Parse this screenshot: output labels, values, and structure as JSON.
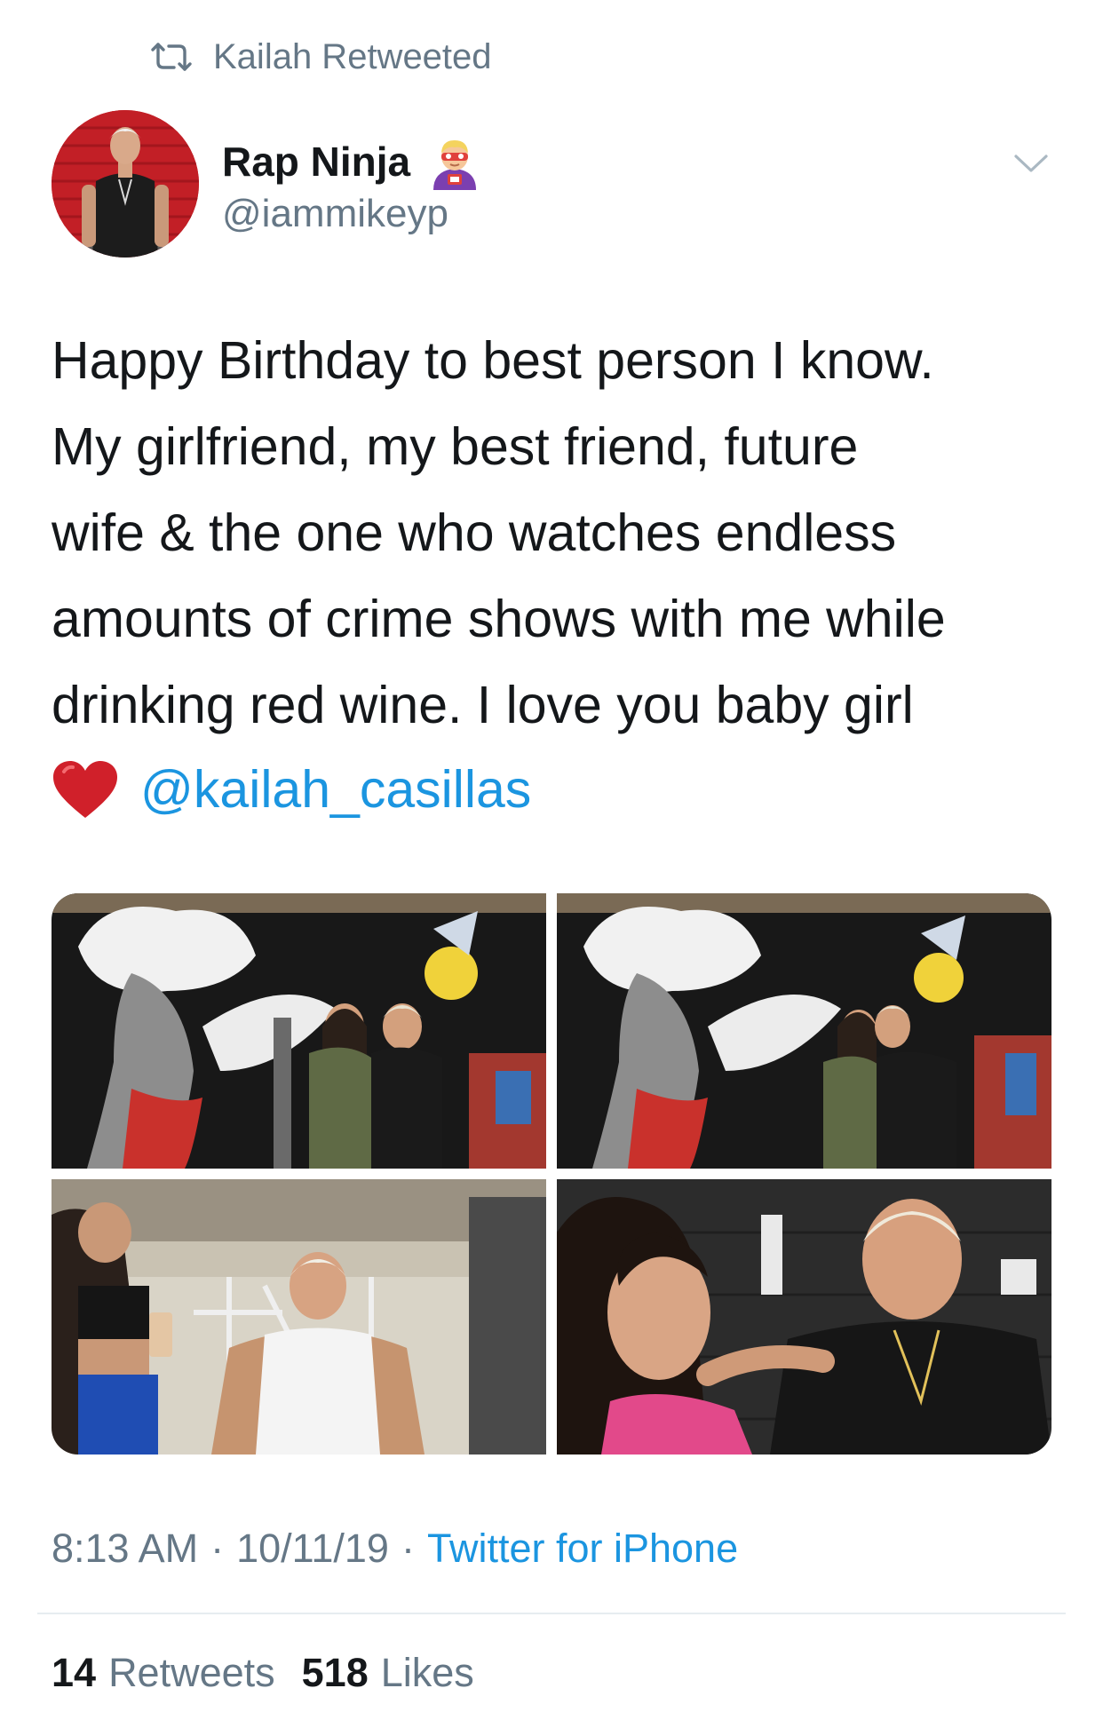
{
  "retweet_context": {
    "icon": "retweet-icon",
    "label": "Kailah Retweeted"
  },
  "author": {
    "display_name": "Rap Ninja",
    "emoji": "ninja-superhero-emoji",
    "handle": "@iammikeyp"
  },
  "menu_icon": "chevron-down-icon",
  "tweet": {
    "text": "Happy Birthday to best person I know.\nMy girlfriend, my best friend, future\nwife & the one who watches endless\namounts of crime shows with me while\ndrinking red wine. I love you baby girl",
    "emoji": "red-heart-emoji",
    "mention": "@kailah_casillas"
  },
  "media": [
    {
      "name": "photo-mural-couple"
    },
    {
      "name": "photo-mural-kiss"
    },
    {
      "name": "photo-gym-selfie"
    },
    {
      "name": "photo-couple-portrait"
    }
  ],
  "meta": {
    "time": "8:13 AM",
    "sep1": "·",
    "date": "10/11/19",
    "sep2": "·",
    "source": "Twitter for iPhone"
  },
  "stats": {
    "retweets_count": "14",
    "retweets_label": "Retweets",
    "likes_count": "518",
    "likes_label": "Likes"
  },
  "colors": {
    "link": "#1b95e0",
    "secondary_text": "#657786",
    "primary_text": "#14171a",
    "divider": "#e6ecf0"
  }
}
